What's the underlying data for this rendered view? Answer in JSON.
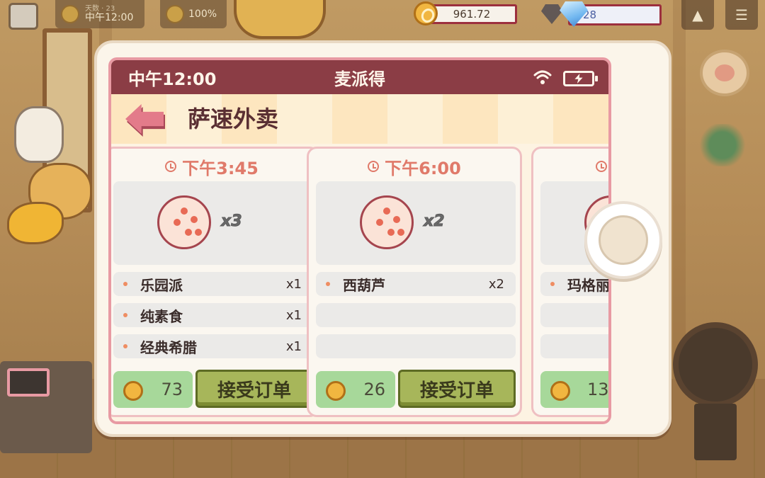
{
  "hud": {
    "weather_line1": "天数 · 23",
    "weather_time": "中午12:00",
    "mood": "100%",
    "coins": "961.72",
    "gems": "28"
  },
  "phone": {
    "time": "中午12:00",
    "carrier": "麦派得",
    "app_title": "萨速外卖"
  },
  "orders": [
    {
      "time": "下午3:45",
      "quantity": "x3",
      "dishes": [
        {
          "name": "乐园派",
          "count": "x1"
        },
        {
          "name": "纯素食",
          "count": "x1"
        },
        {
          "name": "经典希腊",
          "count": "x1"
        }
      ],
      "reward": "73",
      "accept_label": "接受订单"
    },
    {
      "time": "下午6:00",
      "quantity": "x2",
      "dishes": [
        {
          "name": "西葫芦",
          "count": "x2"
        }
      ],
      "reward": "26",
      "accept_label": "接受订单"
    },
    {
      "time": "",
      "quantity": "",
      "dishes": [
        {
          "name": "玛格丽",
          "count": ""
        }
      ],
      "reward": "13",
      "accept_label": ""
    }
  ],
  "icons": {
    "coin": "coin-icon",
    "gem": "diamond-icon",
    "wifi": "wifi-icon",
    "battery": "battery-charging-icon",
    "back": "back-arrow-icon",
    "clock": "clock-icon",
    "pizza": "pizza-icon",
    "home": "home-button"
  },
  "colors": {
    "status_bar": "#8b3d45",
    "accept_button": "#a7b65a",
    "reward_bg": "#a7d89a",
    "time_text": "#e07a6a"
  }
}
